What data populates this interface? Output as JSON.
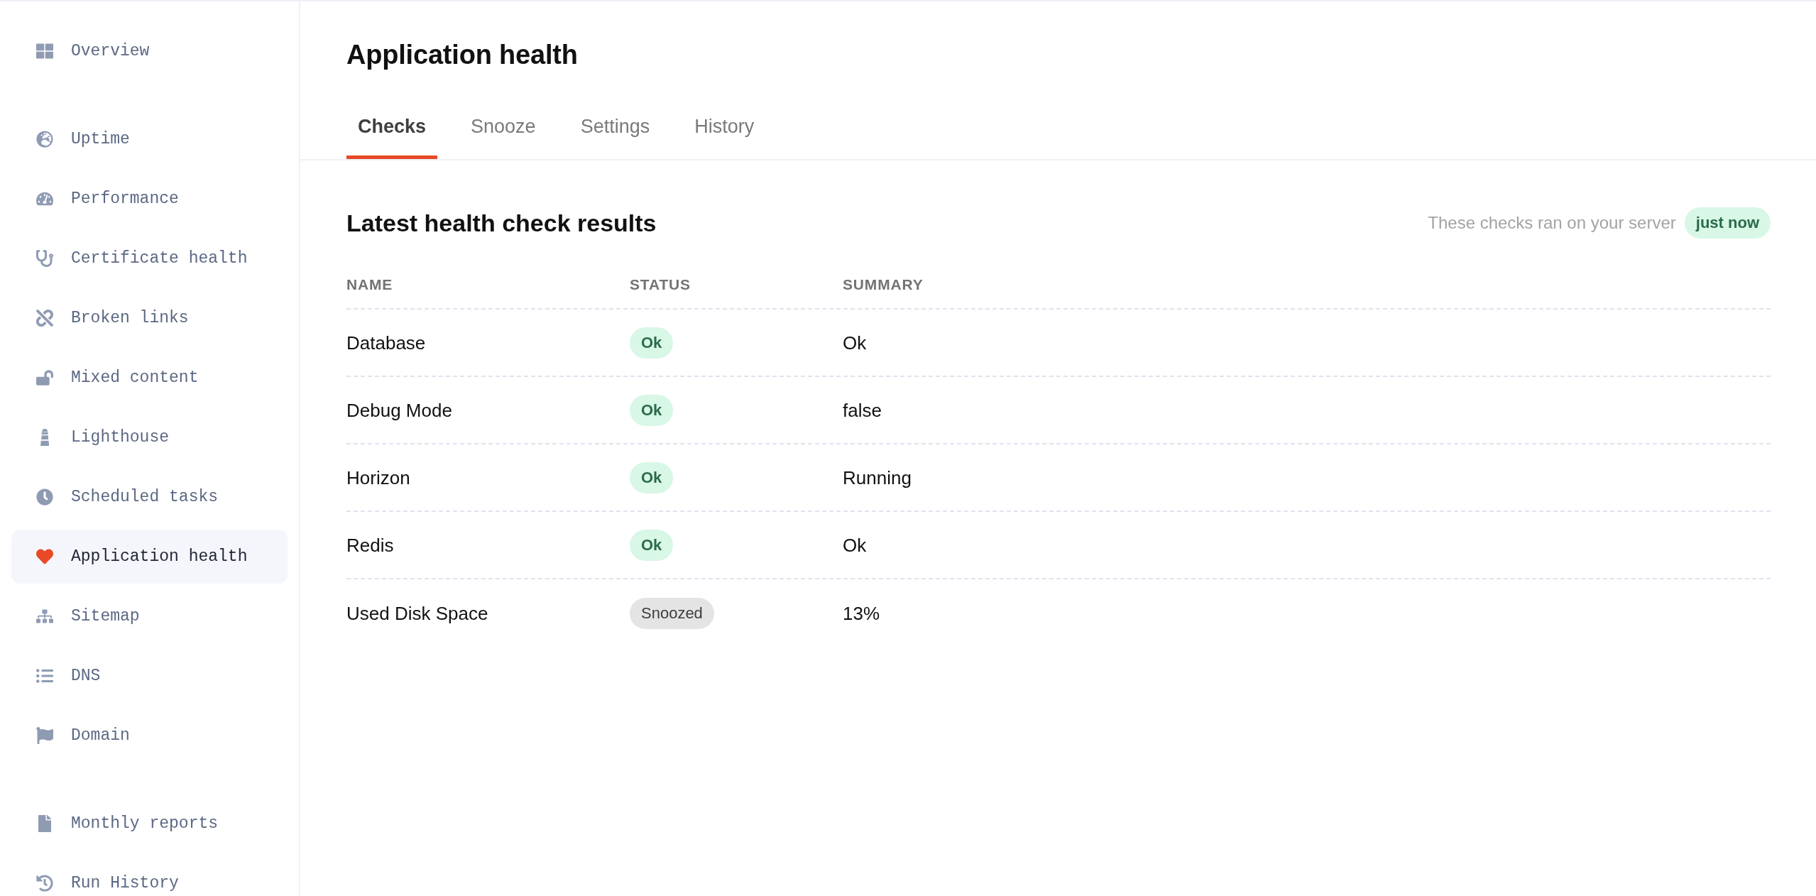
{
  "sidebar": {
    "groups": [
      {
        "items": [
          {
            "label": "Overview",
            "selected": false
          }
        ]
      },
      {
        "items": [
          {
            "label": "Uptime",
            "selected": false
          },
          {
            "label": "Performance",
            "selected": false
          },
          {
            "label": "Certificate health",
            "selected": false
          },
          {
            "label": "Broken links",
            "selected": false
          },
          {
            "label": "Mixed content",
            "selected": false
          },
          {
            "label": "Lighthouse",
            "selected": false
          },
          {
            "label": "Scheduled tasks",
            "selected": false
          },
          {
            "label": "Application health",
            "selected": true
          },
          {
            "label": "Sitemap",
            "selected": false
          },
          {
            "label": "DNS",
            "selected": false
          },
          {
            "label": "Domain",
            "selected": false
          }
        ]
      },
      {
        "items": [
          {
            "label": "Monthly reports",
            "selected": false
          },
          {
            "label": "Run History",
            "selected": false
          }
        ]
      }
    ]
  },
  "page": {
    "title": "Application health"
  },
  "tabs": [
    {
      "label": "Checks",
      "selected": true
    },
    {
      "label": "Snooze",
      "selected": false
    },
    {
      "label": "Settings",
      "selected": false
    },
    {
      "label": "History",
      "selected": false
    }
  ],
  "results": {
    "title": "Latest health check results",
    "note": "These checks ran on your server",
    "ran_at": "just now",
    "table": {
      "columns": [
        "NAME",
        "STATUS",
        "SUMMARY"
      ],
      "rows": [
        {
          "name": "Database",
          "status": {
            "label": "Ok",
            "kind": "ok"
          },
          "summary": "Ok"
        },
        {
          "name": "Debug Mode",
          "status": {
            "label": "Ok",
            "kind": "ok"
          },
          "summary": "false"
        },
        {
          "name": "Horizon",
          "status": {
            "label": "Ok",
            "kind": "ok"
          },
          "summary": "Running"
        },
        {
          "name": "Redis",
          "status": {
            "label": "Ok",
            "kind": "ok"
          },
          "summary": "Ok"
        },
        {
          "name": "Used Disk Space",
          "status": {
            "label": "Snoozed",
            "kind": "snoozed"
          },
          "summary": "13%"
        }
      ]
    }
  }
}
